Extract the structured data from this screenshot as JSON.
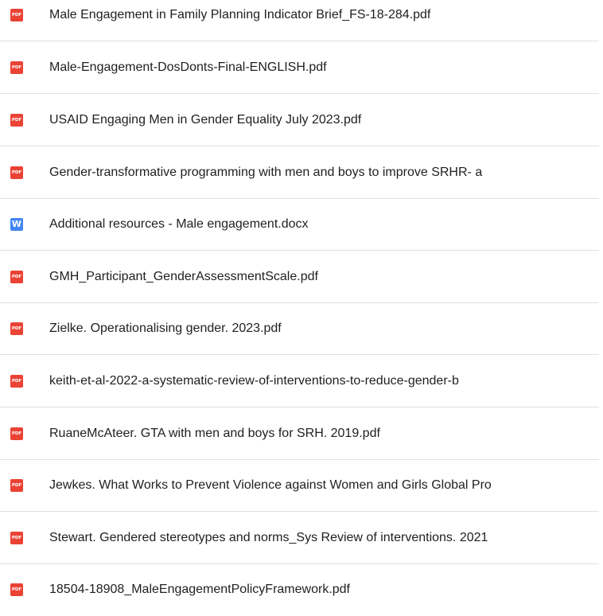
{
  "files": [
    {
      "name": "Male Engagement in Family Planning Indicator Brief_FS-18-284.pdf",
      "icon": "pdf-icon",
      "icon_label": "PDF",
      "icon_color": "#ea4335"
    },
    {
      "name": "Male-Engagement-DosDonts-Final-ENGLISH.pdf",
      "icon": "pdf-icon",
      "icon_label": "PDF",
      "icon_color": "#ea4335"
    },
    {
      "name": "USAID Engaging Men in Gender Equality July 2023.pdf",
      "icon": "pdf-icon",
      "icon_label": "PDF",
      "icon_color": "#ea4335"
    },
    {
      "name": "Gender-transformative programming with men and boys to improve SRHR- a",
      "icon": "pdf-icon",
      "icon_label": "PDF",
      "icon_color": "#ea4335"
    },
    {
      "name": "Additional resources - Male engagement.docx",
      "icon": "docx-icon",
      "icon_label": "W",
      "icon_color": "#4285f4"
    },
    {
      "name": "GMH_Participant_GenderAssessmentScale.pdf",
      "icon": "pdf-icon",
      "icon_label": "PDF",
      "icon_color": "#ea4335"
    },
    {
      "name": "Zielke. Operationalising gender. 2023.pdf",
      "icon": "pdf-icon",
      "icon_label": "PDF",
      "icon_color": "#ea4335"
    },
    {
      "name": "keith-et-al-2022-a-systematic-review-of-interventions-to-reduce-gender-b",
      "icon": "pdf-icon",
      "icon_label": "PDF",
      "icon_color": "#ea4335"
    },
    {
      "name": "RuaneMcAteer. GTA with men and boys for SRH. 2019.pdf",
      "icon": "pdf-icon",
      "icon_label": "PDF",
      "icon_color": "#ea4335"
    },
    {
      "name": "Jewkes. What Works to Prevent Violence against Women and Girls Global Pro",
      "icon": "pdf-icon",
      "icon_label": "PDF",
      "icon_color": "#ea4335"
    },
    {
      "name": "Stewart. Gendered stereotypes and norms_Sys Review of interventions. 2021",
      "icon": "pdf-icon",
      "icon_label": "PDF",
      "icon_color": "#ea4335"
    },
    {
      "name": "18504-18908_MaleEngagementPolicyFramework.pdf",
      "icon": "pdf-icon",
      "icon_label": "PDF",
      "icon_color": "#ea4335"
    }
  ]
}
